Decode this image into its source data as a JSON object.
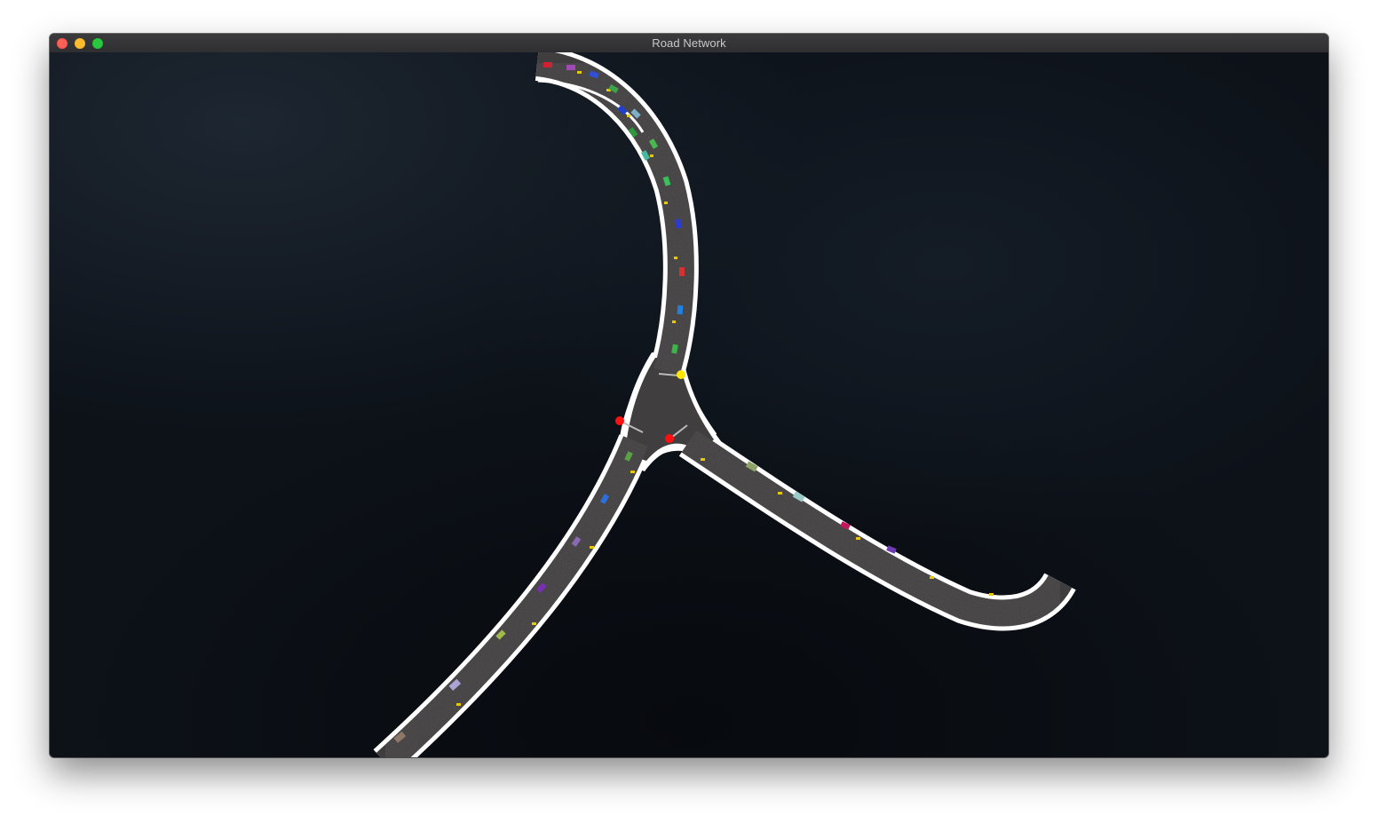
{
  "window": {
    "title": "Road Network"
  },
  "colors": {
    "water": "#0d1219",
    "road_surface": "#3e3b3d",
    "road_edge": "#ffffff",
    "signal_red": "#ff1010",
    "signal_yellow": "#ffe600",
    "lane_marker": "#e8c900"
  },
  "traffic_signals": [
    {
      "state": "yellow"
    },
    {
      "state": "red"
    },
    {
      "state": "red"
    }
  ]
}
